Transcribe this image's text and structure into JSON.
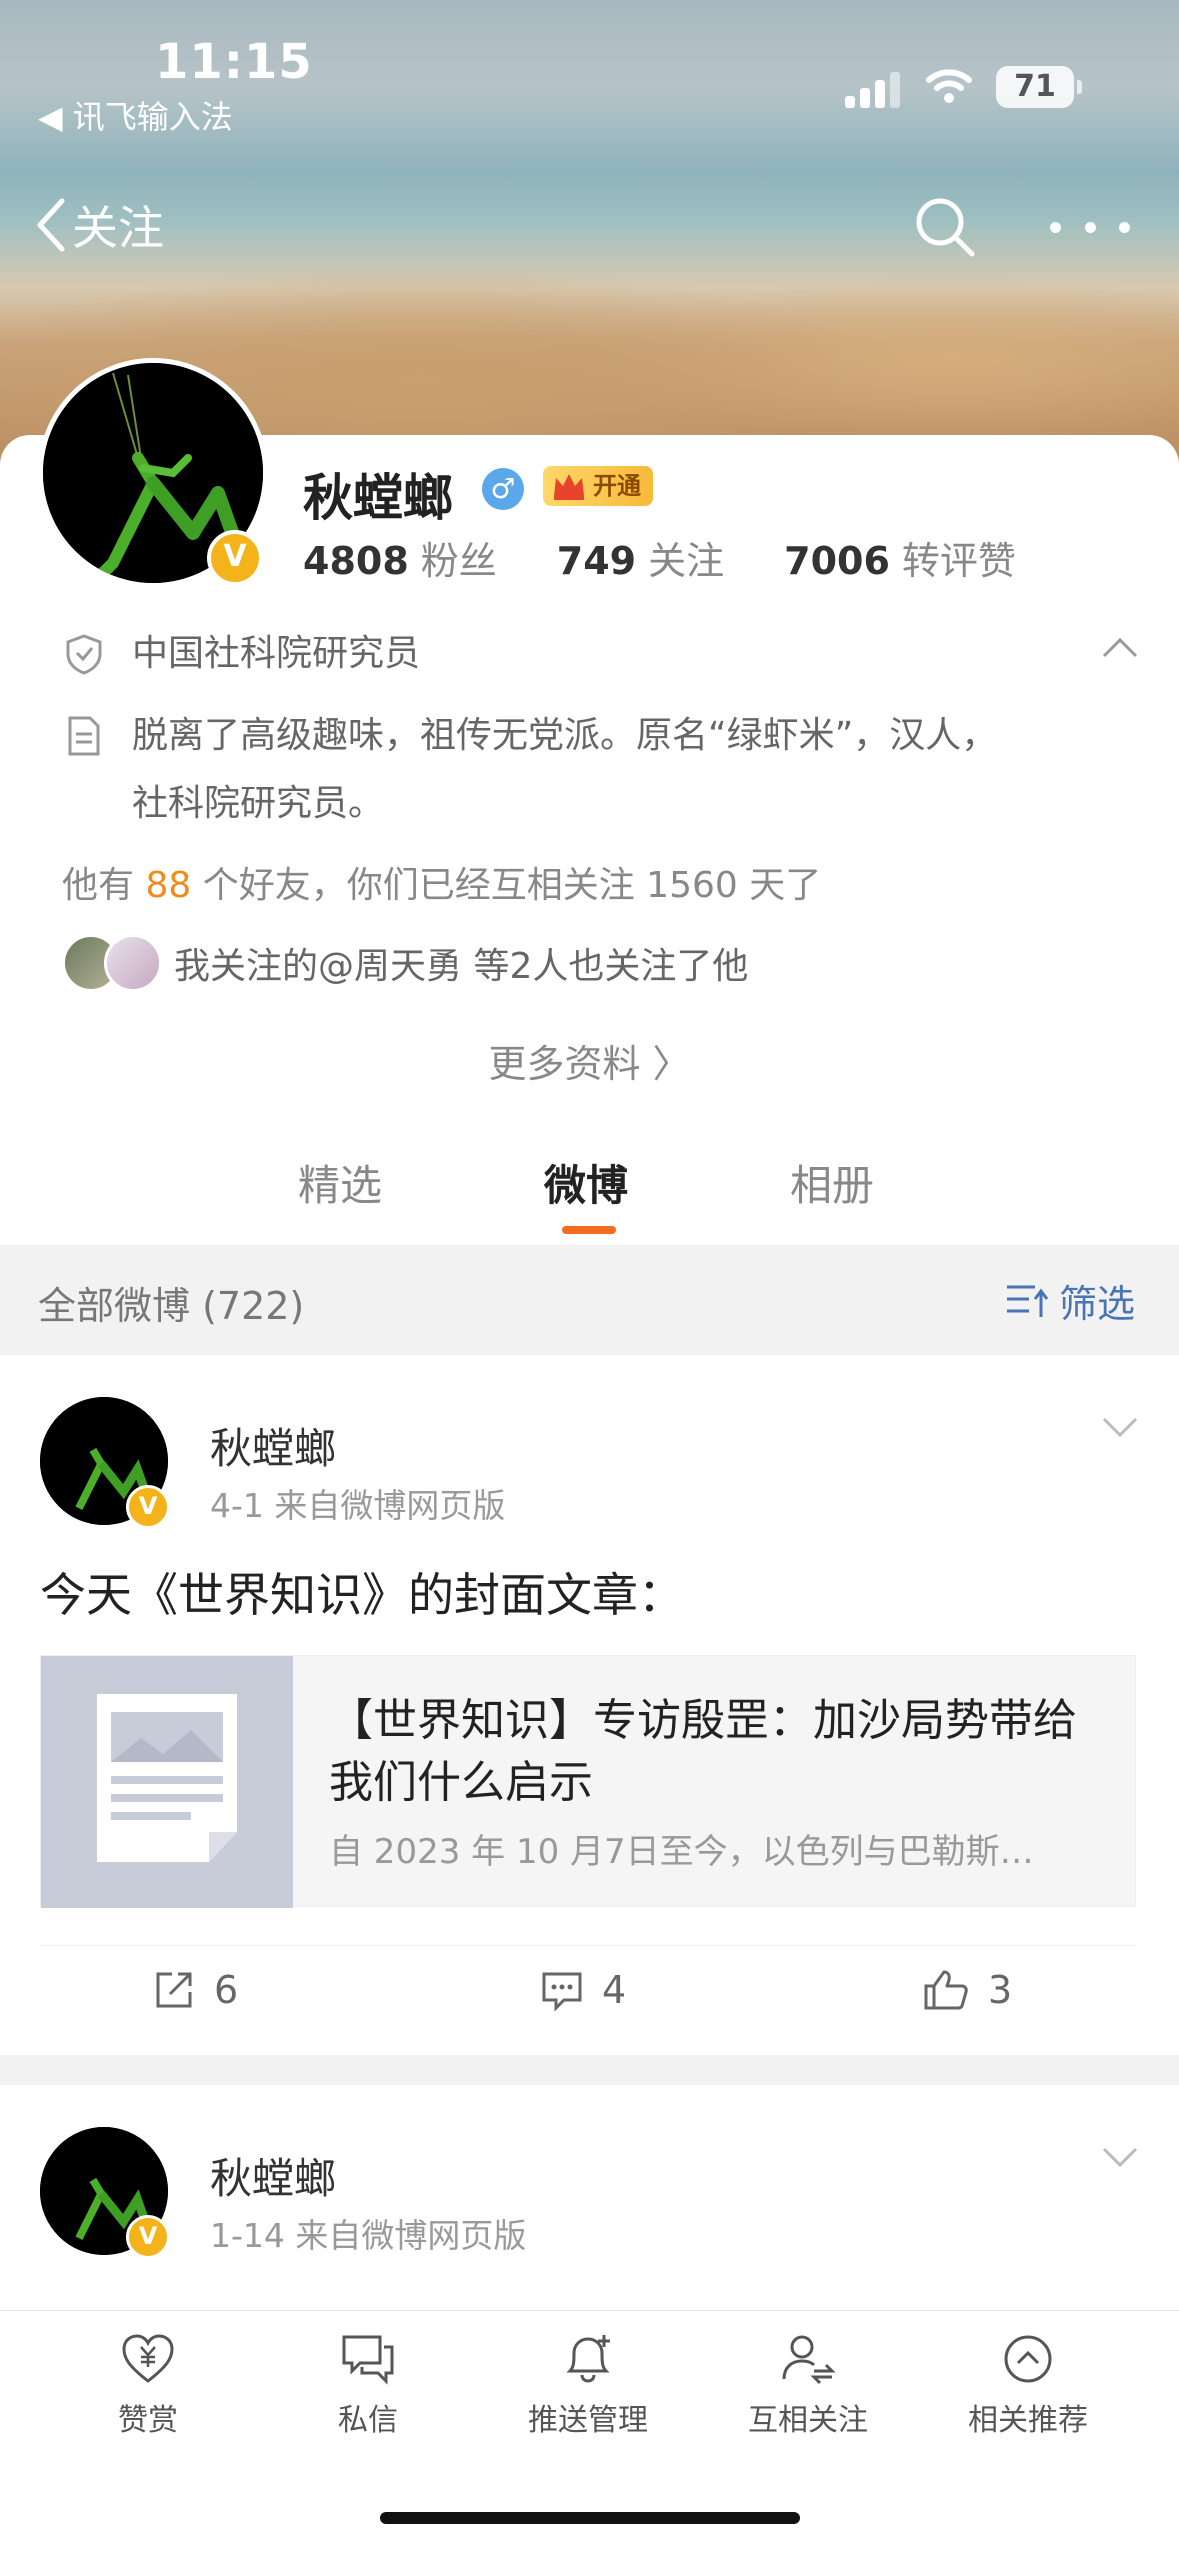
{
  "status_bar": {
    "time": "11:15",
    "back_app": "◀ 讯飞输入法",
    "battery": "71"
  },
  "nav": {
    "back_label": "关注"
  },
  "profile": {
    "name": "秋螳螂",
    "gender_symbol": "♂",
    "vip_label": "开通",
    "stats": [
      {
        "value": "4808",
        "label": "粉丝"
      },
      {
        "value": "749",
        "label": "关注"
      },
      {
        "value": "7006",
        "label": "转评赞"
      }
    ],
    "verification": "中国社科院研究员",
    "bio_line1": "脱离了高级趣味，祖传无党派。原名“绿虾米”，汉人，",
    "bio_line2": "社科院研究员。",
    "friends_prefix": "他有",
    "friends_count": "88",
    "friends_suffix": "个好友，你们已经互相关注 1560 天了",
    "mutual_text": "我关注的@周天勇 等2人也关注了他",
    "more_info": "更多资料 〉"
  },
  "tabs": [
    {
      "label": "精选"
    },
    {
      "label": "微博"
    },
    {
      "label": "相册"
    }
  ],
  "filter": {
    "all_label": "全部微博 (722)",
    "filter_label": "筛选"
  },
  "posts": [
    {
      "author": "秋螳螂",
      "meta": "4-1  来自微博网页版",
      "text": "今天《世界知识》的封面文章：",
      "link_title": "【世界知识】专访殷罡：加沙局势带给我们什么启示",
      "link_summary": "自 2023 年 10 月7日至今，以色列与巴勒斯…",
      "reposts": "6",
      "comments": "4",
      "likes": "3"
    },
    {
      "author": "秋螳螂",
      "meta": "1-14  来自微博网页版"
    }
  ],
  "toolbar": [
    {
      "label": "赞赏",
      "icon": "heart-yen-icon"
    },
    {
      "label": "私信",
      "icon": "message-icon"
    },
    {
      "label": "推送管理",
      "icon": "bell-plus-icon"
    },
    {
      "label": "互相关注",
      "icon": "mutual-follow-icon"
    },
    {
      "label": "相关推荐",
      "icon": "recommend-icon"
    }
  ],
  "colors": {
    "accent": "#f26b21",
    "link_blue": "#4a74b4",
    "vip_gold": "#f5b31b"
  }
}
